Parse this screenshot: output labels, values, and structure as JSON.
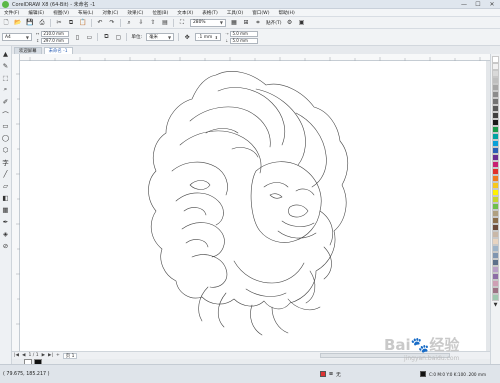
{
  "window": {
    "title": "CorelDRAW X8 (64-Bit) - 未命名 -1"
  },
  "window_controls": [
    "—",
    "☐",
    "✕"
  ],
  "menu": [
    "文件(F)",
    "编辑(E)",
    "视图(V)",
    "布局(L)",
    "对象(C)",
    "效果(C)",
    "位图(B)",
    "文本(X)",
    "表格(T)",
    "工具(O)",
    "窗口(W)",
    "帮助(H)"
  ],
  "toolbar": {
    "zoom": "280%",
    "snap_label": "贴齐(T)",
    "icons": [
      "new-icon",
      "open-icon",
      "save-icon",
      "print-icon",
      "cut-icon",
      "copy-icon",
      "paste-icon",
      "undo-icon",
      "redo-icon",
      "search-icon",
      "import-icon",
      "export-icon",
      "pdf-icon"
    ]
  },
  "property_bar": {
    "page_size": "A4",
    "width": "210.0 mm",
    "height": "297.0 mm",
    "units_label": "单位:",
    "units": "毫米",
    "nudge": ".1 mm",
    "dup_x": "5.0 mm",
    "dup_y": "5.0 mm"
  },
  "tabs": [
    {
      "label": "欢迎屏幕",
      "active": false
    },
    {
      "label": "未命名 -1",
      "active": true
    }
  ],
  "toolbox": [
    "▲",
    "✎",
    "⬚",
    "⌕",
    "✐",
    "⌒",
    "▭",
    "◯",
    "⬡",
    "字",
    "╱",
    "▱",
    "◧",
    "▦",
    "✒",
    "◈",
    "⊘"
  ],
  "palette": [
    "#ffffff",
    "#f2f2f2",
    "#d9d9d9",
    "#bfbfbf",
    "#a6a6a6",
    "#8c8c8c",
    "#737373",
    "#595959",
    "#404040",
    "#1a1a1a",
    "#1a9b4b",
    "#00a3a3",
    "#0aa0d8",
    "#2b5fb5",
    "#6a2d91",
    "#c81f71",
    "#e0302b",
    "#f07b1e",
    "#f7c81c",
    "#fff200",
    "#c7d530",
    "#6fbf4a",
    "#b0a080",
    "#8a6d4a",
    "#6b4a3a",
    "#c9b8a8",
    "#e8d4c0",
    "#9fb4c8",
    "#7f95b0",
    "#5b6f8a",
    "#b89fc7",
    "#8d6ea5",
    "#cfa0b5",
    "#9d7385",
    "#a0c8b0"
  ],
  "page_nav": {
    "first": "|◀",
    "prev": "◀",
    "page_count": "1 / 1",
    "next": "▶",
    "last": "▶|",
    "add": "+",
    "page_tab": "页 1"
  },
  "status": {
    "coords": "( 79.675, 185.217 )",
    "fill_none": "无",
    "outline_info": "C:0 M:0 Y:0 K:100  .200 mm"
  },
  "watermark": {
    "text": "Bai🐾经验",
    "sub": "jingyan.baidu.com"
  }
}
